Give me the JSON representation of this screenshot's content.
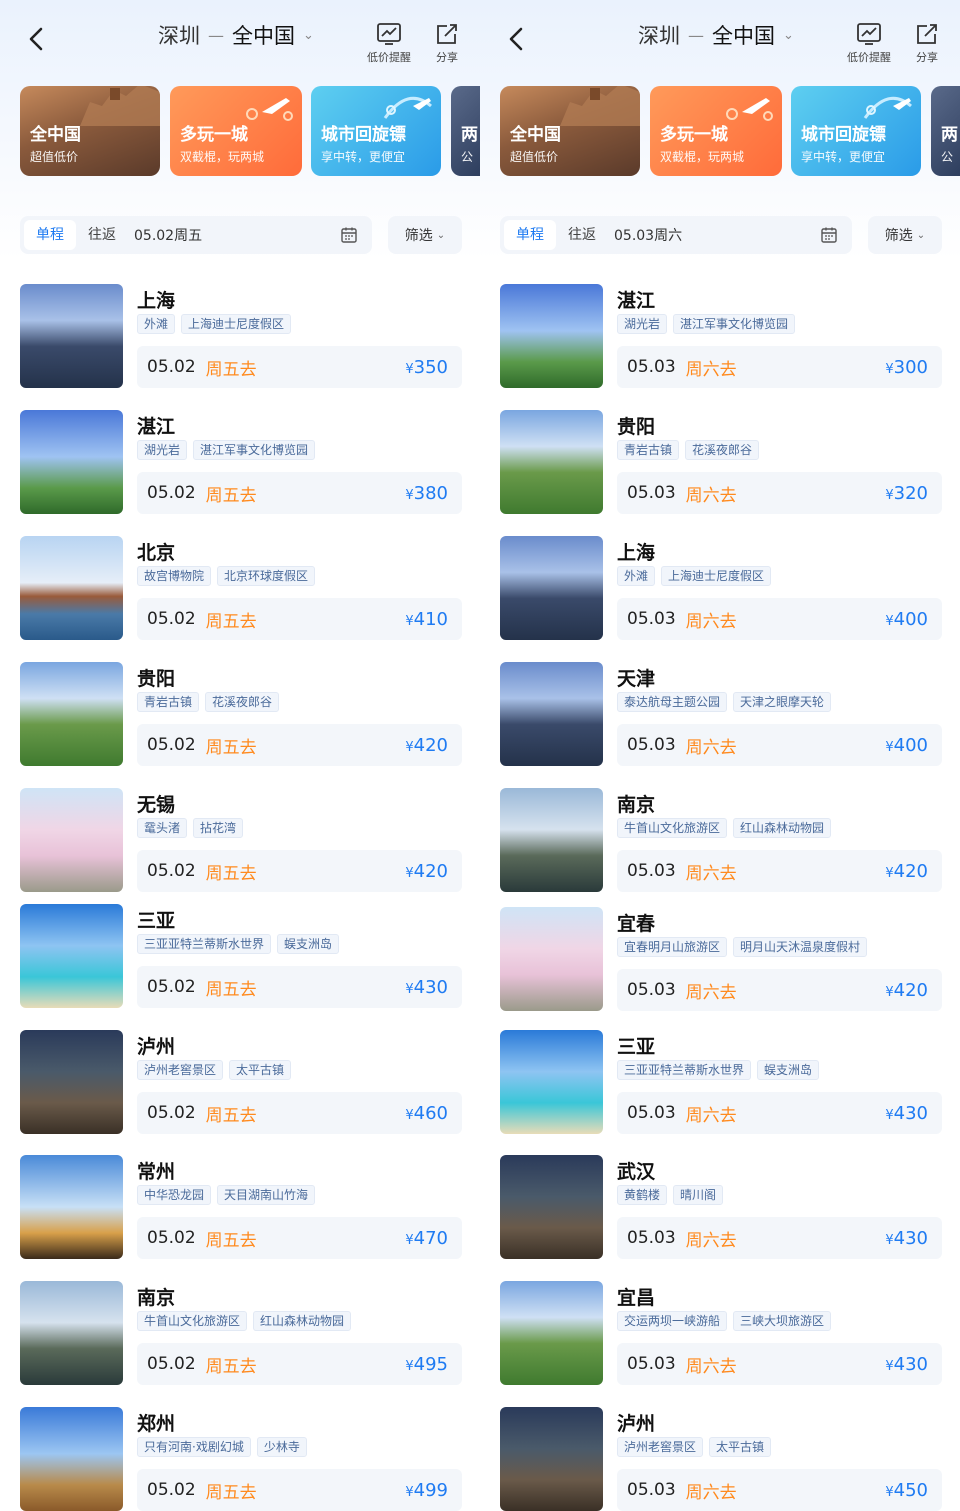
{
  "header": {
    "from": "深圳",
    "dash": "—",
    "to": "全中国",
    "alert_label": "低价提醒",
    "share_label": "分享"
  },
  "banners": [
    {
      "title": "全中国",
      "subtitle": "超值低价"
    },
    {
      "title": "多玩一城",
      "subtitle": "双截棍，玩两城"
    },
    {
      "title": "城市回旋镖",
      "subtitle": "享中转，更便宜"
    },
    {
      "title": "两",
      "subtitle": "公"
    }
  ],
  "filter": {
    "oneway": "单程",
    "roundtrip": "往返",
    "sift": "筛选"
  },
  "colors": {
    "accent": "#1f7bf2",
    "weekday": "#ff8a1e"
  },
  "currency": "¥",
  "left": {
    "date": "05.02周五",
    "items": [
      {
        "city": "上海",
        "tags": [
          "外滩",
          "上海迪士尼度假区"
        ],
        "date": "05.02",
        "weekday": "周五去",
        "price": "350"
      },
      {
        "city": "湛江",
        "tags": [
          "湖光岩",
          "湛江军事文化博览园"
        ],
        "date": "05.02",
        "weekday": "周五去",
        "price": "380"
      },
      {
        "city": "北京",
        "tags": [
          "故宫博物院",
          "北京环球度假区"
        ],
        "date": "05.02",
        "weekday": "周五去",
        "price": "410"
      },
      {
        "city": "贵阳",
        "tags": [
          "青岩古镇",
          "花溪夜郎谷"
        ],
        "date": "05.02",
        "weekday": "周五去",
        "price": "420"
      },
      {
        "city": "无锡",
        "tags": [
          "鼋头渚",
          "拈花湾"
        ],
        "date": "05.02",
        "weekday": "周五去",
        "price": "420"
      },
      {
        "city": "三亚",
        "tags": [
          "三亚亚特兰蒂斯水世界",
          "蜈支洲岛"
        ],
        "date": "05.02",
        "weekday": "周五去",
        "price": "430"
      },
      {
        "city": "泸州",
        "tags": [
          "泸州老窖景区",
          "太平古镇"
        ],
        "date": "05.02",
        "weekday": "周五去",
        "price": "460"
      },
      {
        "city": "常州",
        "tags": [
          "中华恐龙园",
          "天目湖南山竹海"
        ],
        "date": "05.02",
        "weekday": "周五去",
        "price": "470"
      },
      {
        "city": "南京",
        "tags": [
          "牛首山文化旅游区",
          "红山森林动物园"
        ],
        "date": "05.02",
        "weekday": "周五去",
        "price": "495"
      },
      {
        "city": "郑州",
        "tags": [
          "只有河南·戏剧幻城",
          "少林寺"
        ],
        "date": "05.02",
        "weekday": "周五去",
        "price": "499"
      }
    ]
  },
  "right": {
    "date": "05.03周六",
    "items": [
      {
        "city": "湛江",
        "tags": [
          "湖光岩",
          "湛江军事文化博览园"
        ],
        "date": "05.03",
        "weekday": "周六去",
        "price": "300"
      },
      {
        "city": "贵阳",
        "tags": [
          "青岩古镇",
          "花溪夜郎谷"
        ],
        "date": "05.03",
        "weekday": "周六去",
        "price": "320"
      },
      {
        "city": "上海",
        "tags": [
          "外滩",
          "上海迪士尼度假区"
        ],
        "date": "05.03",
        "weekday": "周六去",
        "price": "400"
      },
      {
        "city": "天津",
        "tags": [
          "泰达航母主题公园",
          "天津之眼摩天轮"
        ],
        "date": "05.03",
        "weekday": "周六去",
        "price": "400"
      },
      {
        "city": "南京",
        "tags": [
          "牛首山文化旅游区",
          "红山森林动物园"
        ],
        "date": "05.03",
        "weekday": "周六去",
        "price": "420"
      },
      {
        "city": "宜春",
        "tags": [
          "宜春明月山旅游区",
          "明月山天沐温泉度假村"
        ],
        "date": "05.03",
        "weekday": "周六去",
        "price": "420"
      },
      {
        "city": "三亚",
        "tags": [
          "三亚亚特兰蒂斯水世界",
          "蜈支洲岛"
        ],
        "date": "05.03",
        "weekday": "周六去",
        "price": "430"
      },
      {
        "city": "武汉",
        "tags": [
          "黄鹤楼",
          "晴川阁"
        ],
        "date": "05.03",
        "weekday": "周六去",
        "price": "430"
      },
      {
        "city": "宜昌",
        "tags": [
          "交运两坝一峡游船",
          "三峡大坝旅游区"
        ],
        "date": "05.03",
        "weekday": "周六去",
        "price": "430"
      },
      {
        "city": "泸州",
        "tags": [
          "泸州老窖景区",
          "太平古镇"
        ],
        "date": "05.03",
        "weekday": "周六去",
        "price": "450"
      }
    ]
  }
}
